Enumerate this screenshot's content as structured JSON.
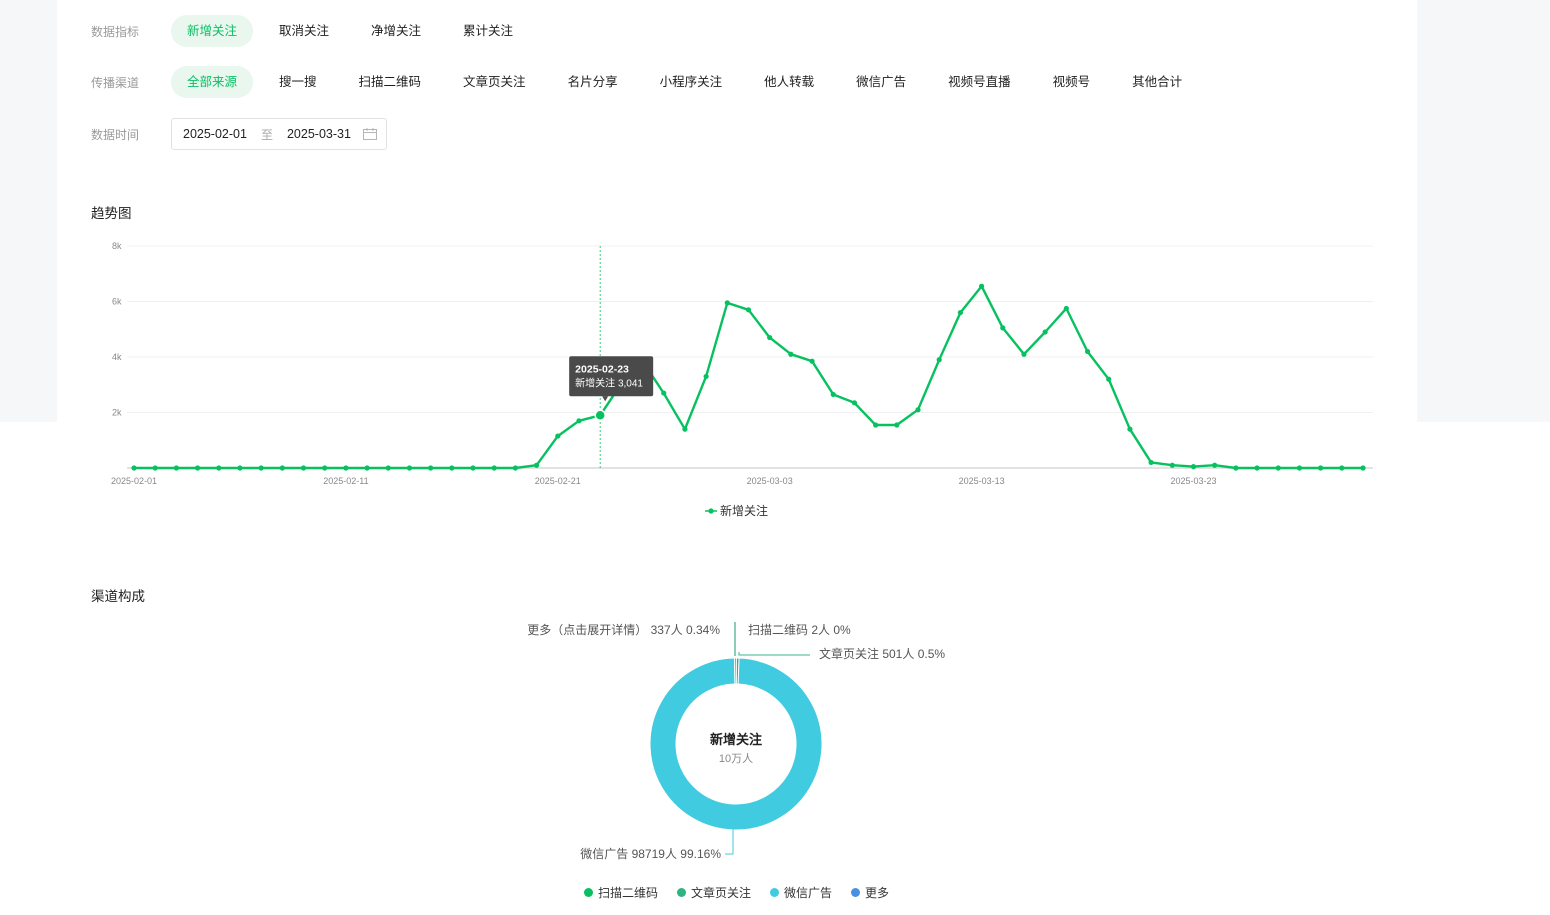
{
  "filters": {
    "metric": {
      "label": "数据指标",
      "options": [
        "新增关注",
        "取消关注",
        "净增关注",
        "累计关注"
      ],
      "active_index": 0
    },
    "channel": {
      "label": "传播渠道",
      "options": [
        "全部来源",
        "搜一搜",
        "扫描二维码",
        "文章页关注",
        "名片分享",
        "小程序关注",
        "他人转载",
        "微信广告",
        "视频号直播",
        "视频号",
        "其他合计"
      ],
      "active_index": 0
    },
    "date": {
      "label": "数据时间",
      "start": "2025-02-01",
      "separator": "至",
      "end": "2025-03-31",
      "icon": "calendar-icon"
    }
  },
  "trend": {
    "title": "趋势图",
    "tooltip": {
      "date": "2025-02-23",
      "text": "新增关注 3,041"
    },
    "legend": "新增关注"
  },
  "composition": {
    "title": "渠道构成",
    "center_title": "新增关注",
    "center_sub": "10万人",
    "labels": {
      "more": "更多（点击展开详情） 337人 0.34%",
      "qr": "扫描二维码 2人 0%",
      "article": "文章页关注 501人 0.5%",
      "ad": "微信广告 98719人 99.16%"
    },
    "legend": [
      {
        "name": "扫描二维码",
        "color": "#07c160"
      },
      {
        "name": "文章页关注",
        "color": "#2fb381"
      },
      {
        "name": "微信广告",
        "color": "#41cbe1"
      },
      {
        "name": "更多",
        "color": "#4a90e2"
      }
    ]
  },
  "chart_data": [
    {
      "type": "line",
      "title": "趋势图",
      "series": [
        {
          "name": "新增关注",
          "color": "#07c160",
          "values": [
            0,
            0,
            0,
            0,
            0,
            0,
            0,
            0,
            0,
            0,
            0,
            0,
            0,
            0,
            0,
            0,
            0,
            0,
            0,
            100,
            1150,
            1700,
            1900,
            3041,
            3850,
            2700,
            1400,
            3300,
            5950,
            5700,
            4700,
            4100,
            3850,
            2650,
            2350,
            1550,
            1550,
            2100,
            3900,
            5600,
            6550,
            5050,
            4100,
            4900,
            5750,
            4200,
            3200,
            1400,
            200,
            100,
            50,
            100,
            0,
            0,
            0,
            0,
            0,
            0,
            0
          ]
        }
      ],
      "x_start": "2025-02-01",
      "x_end": "2025-03-31",
      "x_tick_labels": [
        "2025-02-01",
        "2025-02-11",
        "2025-02-21",
        "2025-03-03",
        "2025-03-13",
        "2025-03-23"
      ],
      "y_tick_labels": [
        "2k",
        "4k",
        "6k",
        "8k"
      ],
      "ylim": [
        0,
        8000
      ],
      "grid": true,
      "legend": "bottom-center"
    },
    {
      "type": "pie",
      "title": "渠道构成",
      "slices": [
        {
          "name": "扫描二维码",
          "value": 2,
          "percent": 0
        },
        {
          "name": "文章页关注",
          "value": 501,
          "percent": 0.5
        },
        {
          "name": "微信广告",
          "value": 98719,
          "percent": 99.16
        },
        {
          "name": "更多",
          "value": 337,
          "percent": 0.34
        }
      ]
    }
  ]
}
